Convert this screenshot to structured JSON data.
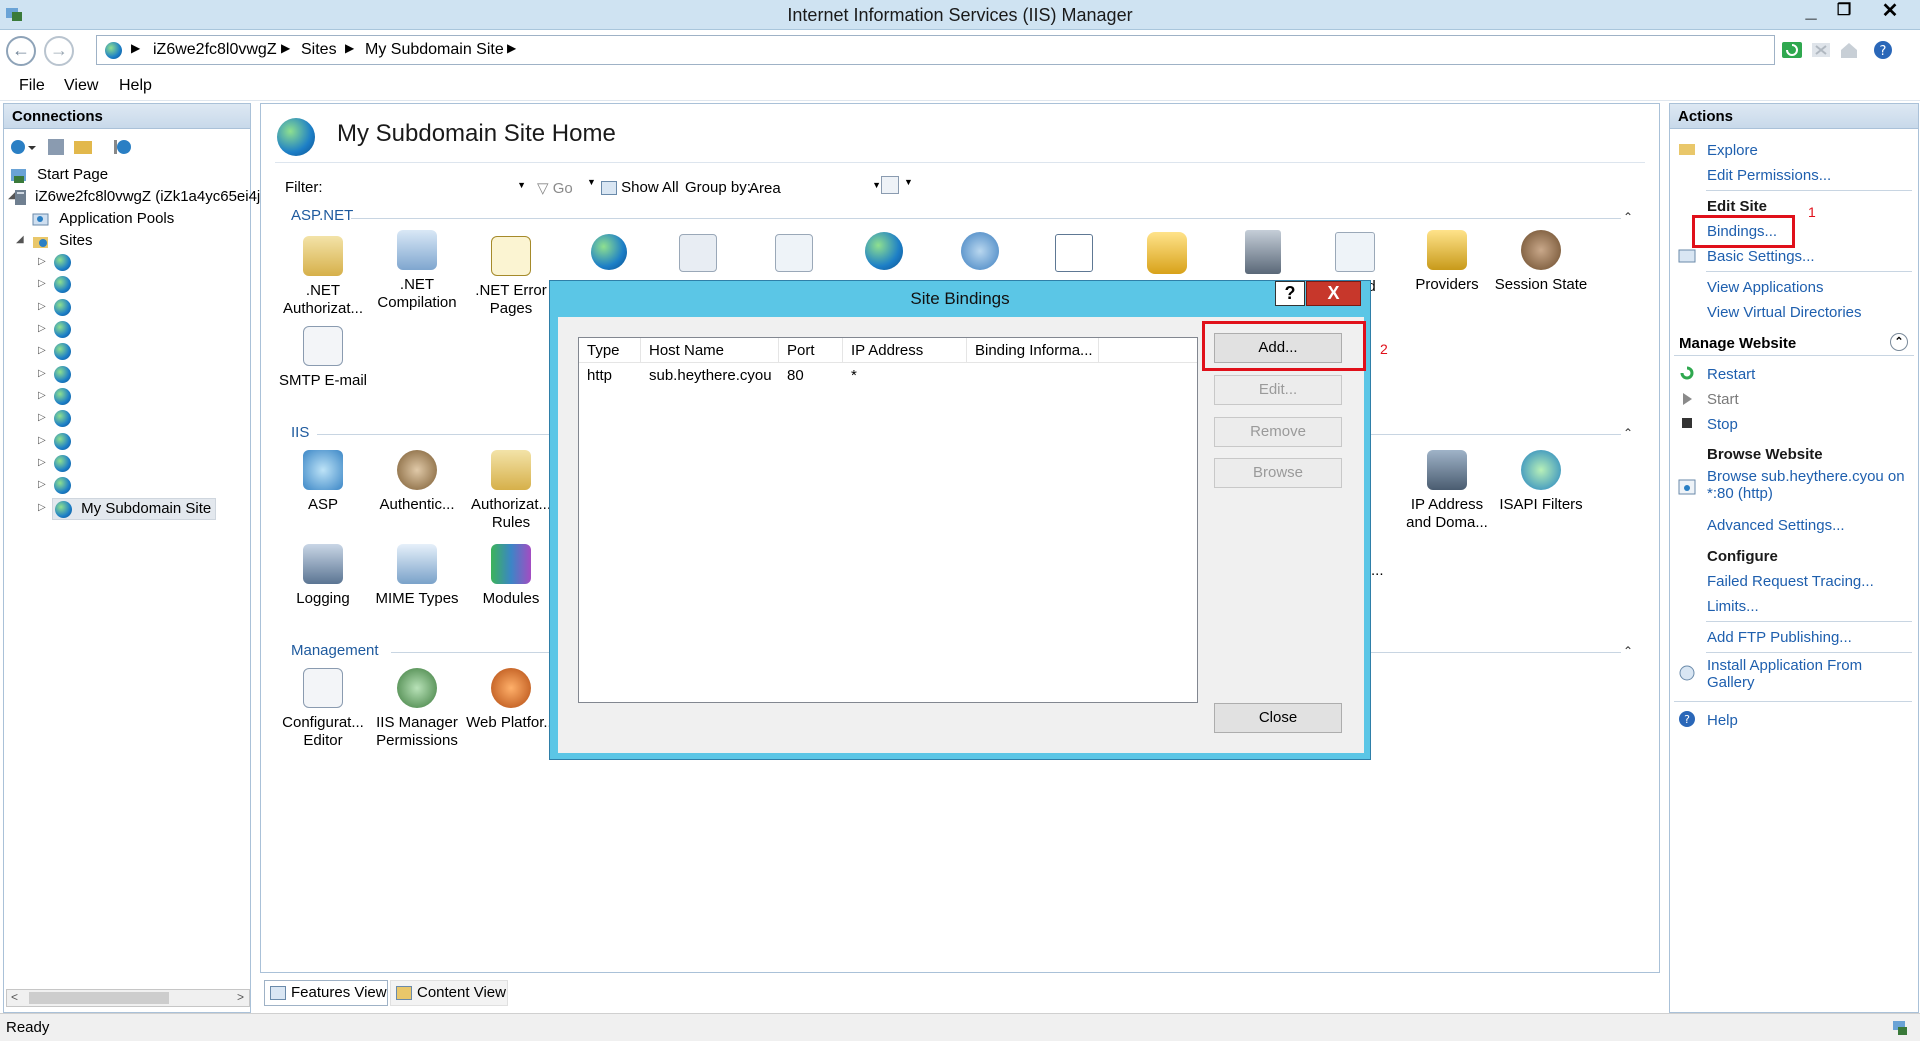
{
  "window": {
    "title": "Internet Information Services (IIS) Manager"
  },
  "address": {
    "crumbs": [
      "iZ6we2fc8l0vwgZ",
      "Sites",
      "My Subdomain Site"
    ]
  },
  "menu": [
    "File",
    "View",
    "Help"
  ],
  "connections": {
    "title": "Connections",
    "start_page": "Start Page",
    "server": "iZ6we2fc8l0vwgZ (iZk1a4yc65ei4j",
    "app_pools": "Application Pools",
    "sites": "Sites",
    "selected_site": "My Subdomain Site"
  },
  "center": {
    "title": "My Subdomain Site Home",
    "filter_label": "Filter:",
    "go": "Go",
    "show_all": "Show All",
    "group_by_label": "Group by:",
    "group_by_value": "Area",
    "groups": {
      "aspnet": "ASP.NET",
      "iis": "IIS",
      "management": "Management"
    },
    "features": {
      "net_auth": ".NET Authorizat...",
      "net_comp": ".NET Compilation",
      "net_err": ".NET Error Pages",
      "smtp": "SMTP E-mail",
      "hidden_partial": "nd ls",
      "providers": "Providers",
      "session": "Session State",
      "asp": "ASP",
      "authentic": "Authentic...",
      "authz_rules": "Authorizat... Rules",
      "ip_addr": "IP Address and Doma...",
      "isapi": "ISAPI Filters",
      "ellipsis": "...",
      "logging": "Logging",
      "mime": "MIME Types",
      "modules": "Modules",
      "config_editor": "Configurat... Editor",
      "iis_mgr_perm": "IIS Manager Permissions",
      "web_platform": "Web Platfor..."
    },
    "tabs": {
      "features": "Features View",
      "content": "Content View"
    }
  },
  "actions": {
    "title": "Actions",
    "explore": "Explore",
    "edit_permissions": "Edit Permissions...",
    "edit_site": "Edit Site",
    "bindings": "Bindings...",
    "basic_settings": "Basic Settings...",
    "view_applications": "View Applications",
    "view_vdirs": "View Virtual Directories",
    "manage_website": "Manage Website",
    "restart": "Restart",
    "start": "Start",
    "stop": "Stop",
    "browse_website": "Browse Website",
    "browse_link_1": "Browse sub.heythere.cyou on",
    "browse_link_2": "*:80 (http)",
    "advanced_settings": "Advanced Settings...",
    "configure": "Configure",
    "failed_tracing": "Failed Request Tracing...",
    "limits": "Limits...",
    "add_ftp": "Add FTP Publishing...",
    "install_app_1": "Install Application From",
    "install_app_2": "Gallery",
    "help": "Help",
    "marker_1": "1",
    "marker_2": "2"
  },
  "dialog": {
    "title": "Site Bindings",
    "help_btn": "?",
    "close_x": "X",
    "columns": [
      "Type",
      "Host Name",
      "Port",
      "IP Address",
      "Binding Informa..."
    ],
    "rows": [
      {
        "type": "http",
        "host": "sub.heythere.cyou",
        "port": "80",
        "ip": "*",
        "info": ""
      }
    ],
    "buttons": {
      "add": "Add...",
      "edit": "Edit...",
      "remove": "Remove",
      "browse": "Browse",
      "close": "Close"
    }
  },
  "status": {
    "text": "Ready"
  }
}
